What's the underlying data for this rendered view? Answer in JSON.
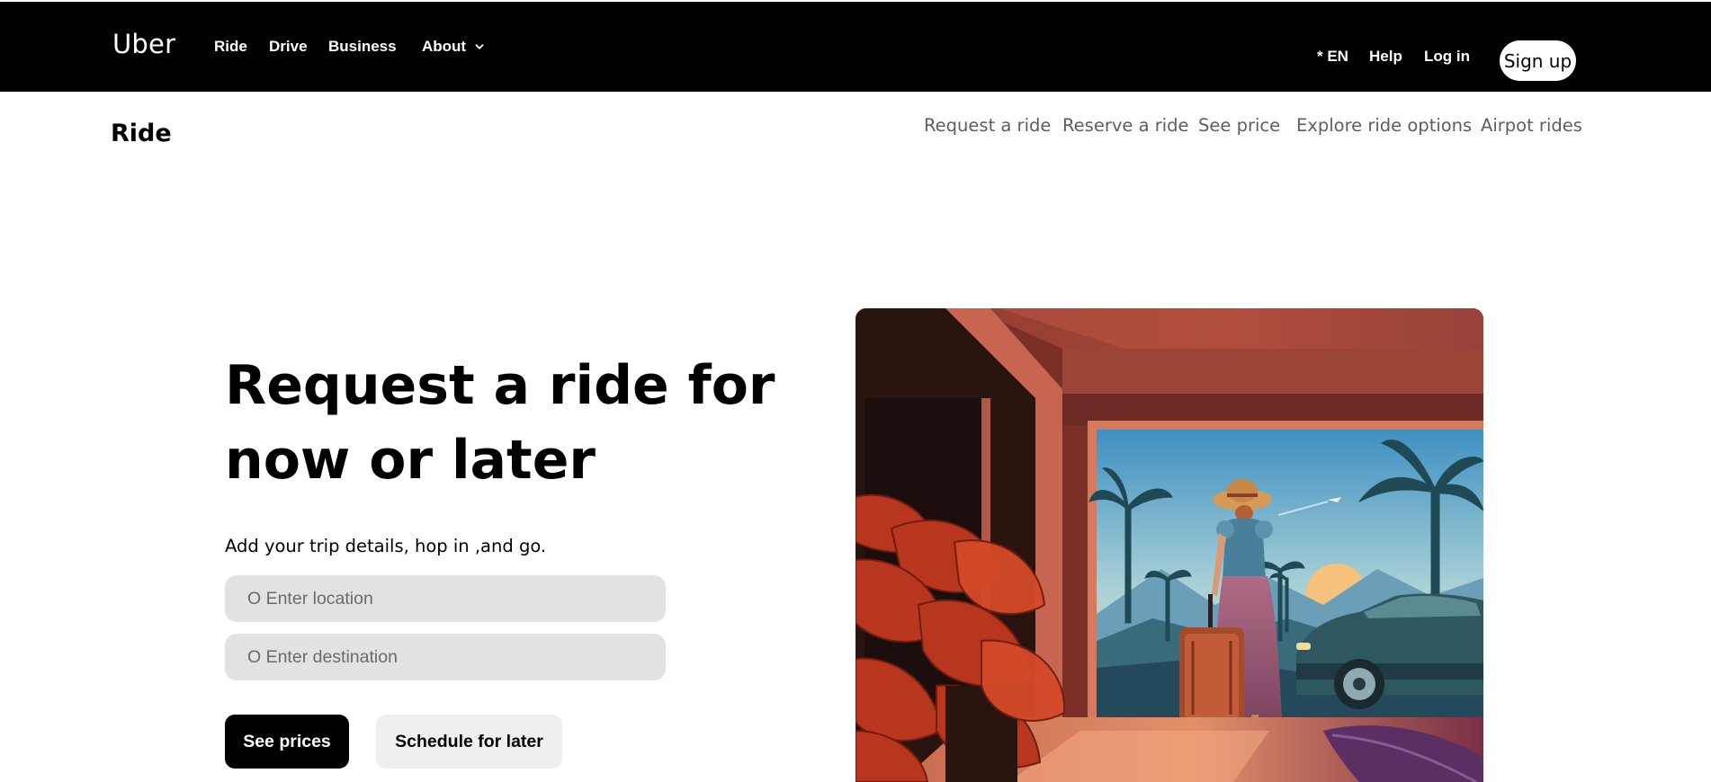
{
  "header": {
    "logo": "Uber",
    "nav_left": [
      "Ride",
      "Drive",
      "Business"
    ],
    "about_label": "About",
    "language": "* EN",
    "help": "Help",
    "login": "Log in",
    "signup": "Sign up"
  },
  "subnav": {
    "title": "Ride",
    "links": [
      "Request a ride",
      "Reserve a ride",
      "See price",
      "Explore ride options",
      "Airpot rides"
    ]
  },
  "hero": {
    "title_line1": "Request a ride for",
    "title_line2": "now or later",
    "subtitle": "Add your trip details, hop in ,and go.",
    "location_placeholder": "O Enter location",
    "destination_placeholder": "O Enter destination",
    "see_prices": "See prices",
    "schedule": "Schedule for later"
  },
  "icons": {
    "about_dropdown": "chevron-down-icon"
  },
  "colors": {
    "topbar": "#000000",
    "subnav_link": "#5e5e5e",
    "input_bg": "#e2e2e2",
    "primary_button": "#000000",
    "secondary_button": "#efefef"
  }
}
